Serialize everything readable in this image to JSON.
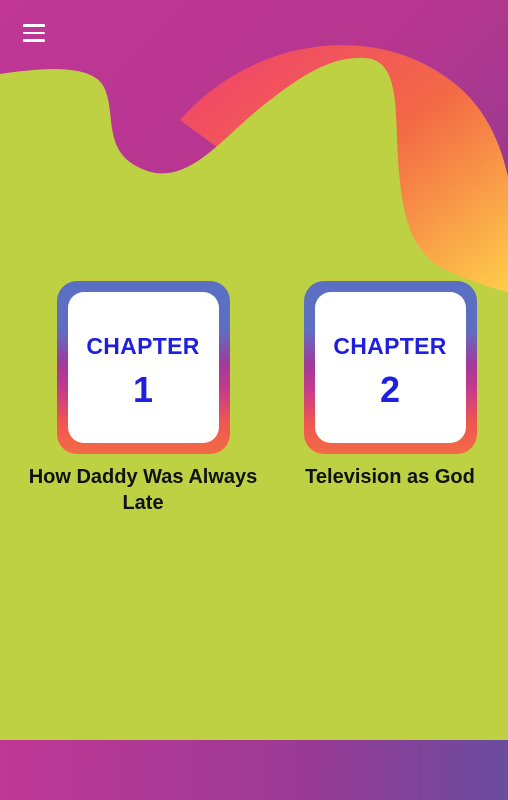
{
  "colors": {
    "panel": "#bed143",
    "accent_text": "#1f1fe0",
    "title_text": "#111111",
    "magenta": "#c03795",
    "purple": "#6a4c9e",
    "orange": "#f36a45",
    "yellow": "#ffd34a"
  },
  "header": {
    "menu_icon": "hamburger-menu-icon"
  },
  "chapters": [
    {
      "label": "CHAPTER",
      "number": "1",
      "title": "How Daddy Was Always Late"
    },
    {
      "label": "CHAPTER",
      "number": "2",
      "title": "Television as God"
    }
  ]
}
